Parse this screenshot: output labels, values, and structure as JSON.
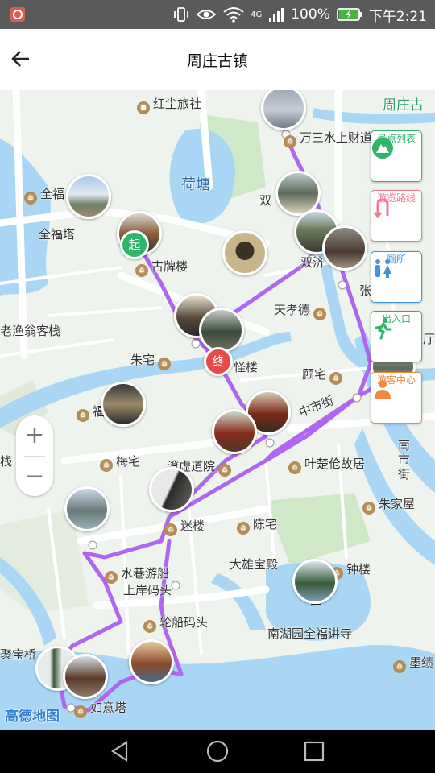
{
  "status": {
    "network": "4G",
    "battery": "100%",
    "time": "下午2:21"
  },
  "header": {
    "title": "周庄古镇"
  },
  "map": {
    "labels": [
      {
        "id": "hongshe",
        "text": "红尘旅社"
      },
      {
        "id": "zhouzhuang_gu",
        "text": "周庄古"
      },
      {
        "id": "hetang",
        "text": "荷塘"
      },
      {
        "id": "wansan",
        "text": "万三水上财道"
      },
      {
        "id": "quanfu_l",
        "text": "全福"
      },
      {
        "id": "shuang",
        "text": "双"
      },
      {
        "id": "quanfuta",
        "text": "全福塔"
      },
      {
        "id": "gupailou",
        "text": "古牌楼"
      },
      {
        "id": "shuangji",
        "text": "双济"
      },
      {
        "id": "zhang",
        "text": "张"
      },
      {
        "id": "tianxiaode",
        "text": "天孝德"
      },
      {
        "id": "yuwengke",
        "text": "老渔翁客栈"
      },
      {
        "id": "zhuzhai",
        "text": "朱宅"
      },
      {
        "id": "guailou",
        "text": "怪楼"
      },
      {
        "id": "guzhai",
        "text": "顾宅"
      },
      {
        "id": "zhongshijie",
        "text": "中市街"
      },
      {
        "id": "fu",
        "text": "福"
      },
      {
        "id": "yechuzhe",
        "text": "叶楚伧故居"
      },
      {
        "id": "meizhai",
        "text": "梅宅"
      },
      {
        "id": "chengxu",
        "text": "澄虚道院"
      },
      {
        "id": "nanshijie",
        "text": "南市街"
      },
      {
        "id": "zhan",
        "text": "栈"
      },
      {
        "id": "zhujiawu",
        "text": "朱家屋"
      },
      {
        "id": "milou",
        "text": "迷楼"
      },
      {
        "id": "chenzhai",
        "text": "陈宅"
      },
      {
        "id": "daxiong",
        "text": "大雄宝殿"
      },
      {
        "id": "zhonglou",
        "text": "钟楼"
      },
      {
        "id": "shuixiang1",
        "text": "水巷游船"
      },
      {
        "id": "shuixiang2",
        "text": "上岸码头"
      },
      {
        "id": "lunchuan",
        "text": "轮船码头"
      },
      {
        "id": "nanhuyuan",
        "text": "南湖园全福讲寺"
      },
      {
        "id": "jubaoqiao",
        "text": "聚宝桥"
      },
      {
        "id": "moji",
        "text": "墨绩"
      },
      {
        "id": "ruyita",
        "text": "如意塔"
      },
      {
        "id": "ting",
        "text": "厅"
      },
      {
        "id": "yuan",
        "text": "园"
      }
    ],
    "start_marker": "起",
    "end_marker": "终",
    "logo": "高德地图",
    "zoom_in": "+",
    "zoom_out": "−"
  },
  "side_buttons": [
    {
      "label": "景点列表",
      "color": "#2fb56a",
      "icon": "mountain-icon"
    },
    {
      "label": "游览路线",
      "color": "#f07a95",
      "icon": "route-icon"
    },
    {
      "label": "厕所",
      "color": "#3b95e0",
      "icon": "restroom-icon"
    },
    {
      "label": "出入口",
      "color": "#2fb56a",
      "icon": "walk-icon"
    },
    {
      "label": "游客中心",
      "color": "#f08a40",
      "icon": "visitor-icon"
    }
  ],
  "colors": {
    "route": "#b066f0",
    "start": "#2fb56a",
    "end": "#e84a4a",
    "water": "#a9d6f5",
    "road": "#ffffff",
    "green": "#cfe8c8"
  }
}
